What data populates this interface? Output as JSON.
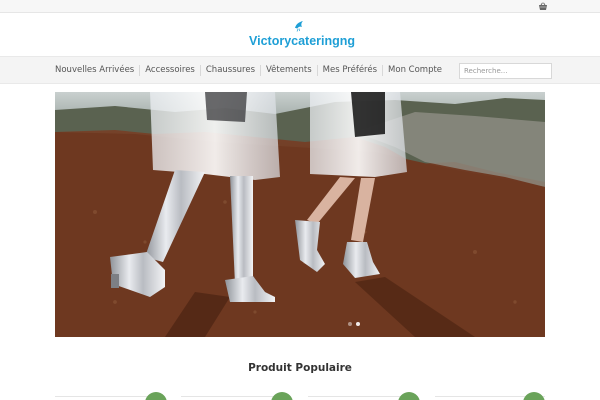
{
  "topbar": {
    "cart_icon": "shopping-basket-icon"
  },
  "logo": {
    "text": "Victorycateringng",
    "icon": "bird-icon",
    "color": "#1e9fd6"
  },
  "nav": {
    "items": [
      {
        "label": "Nouvelles Arrivées"
      },
      {
        "label": "Accessoires"
      },
      {
        "label": "Chaussures"
      },
      {
        "label": "Vêtements"
      },
      {
        "label": "Mes Préférés"
      },
      {
        "label": "Mon Compte"
      }
    ],
    "search_placeholder": "Recherche..."
  },
  "hero": {
    "slide_count": 2,
    "active_slide": 1
  },
  "section": {
    "title": "Produit Populaire"
  },
  "colors": {
    "accent": "#1e9fd6",
    "badge": "#6aa35a"
  }
}
